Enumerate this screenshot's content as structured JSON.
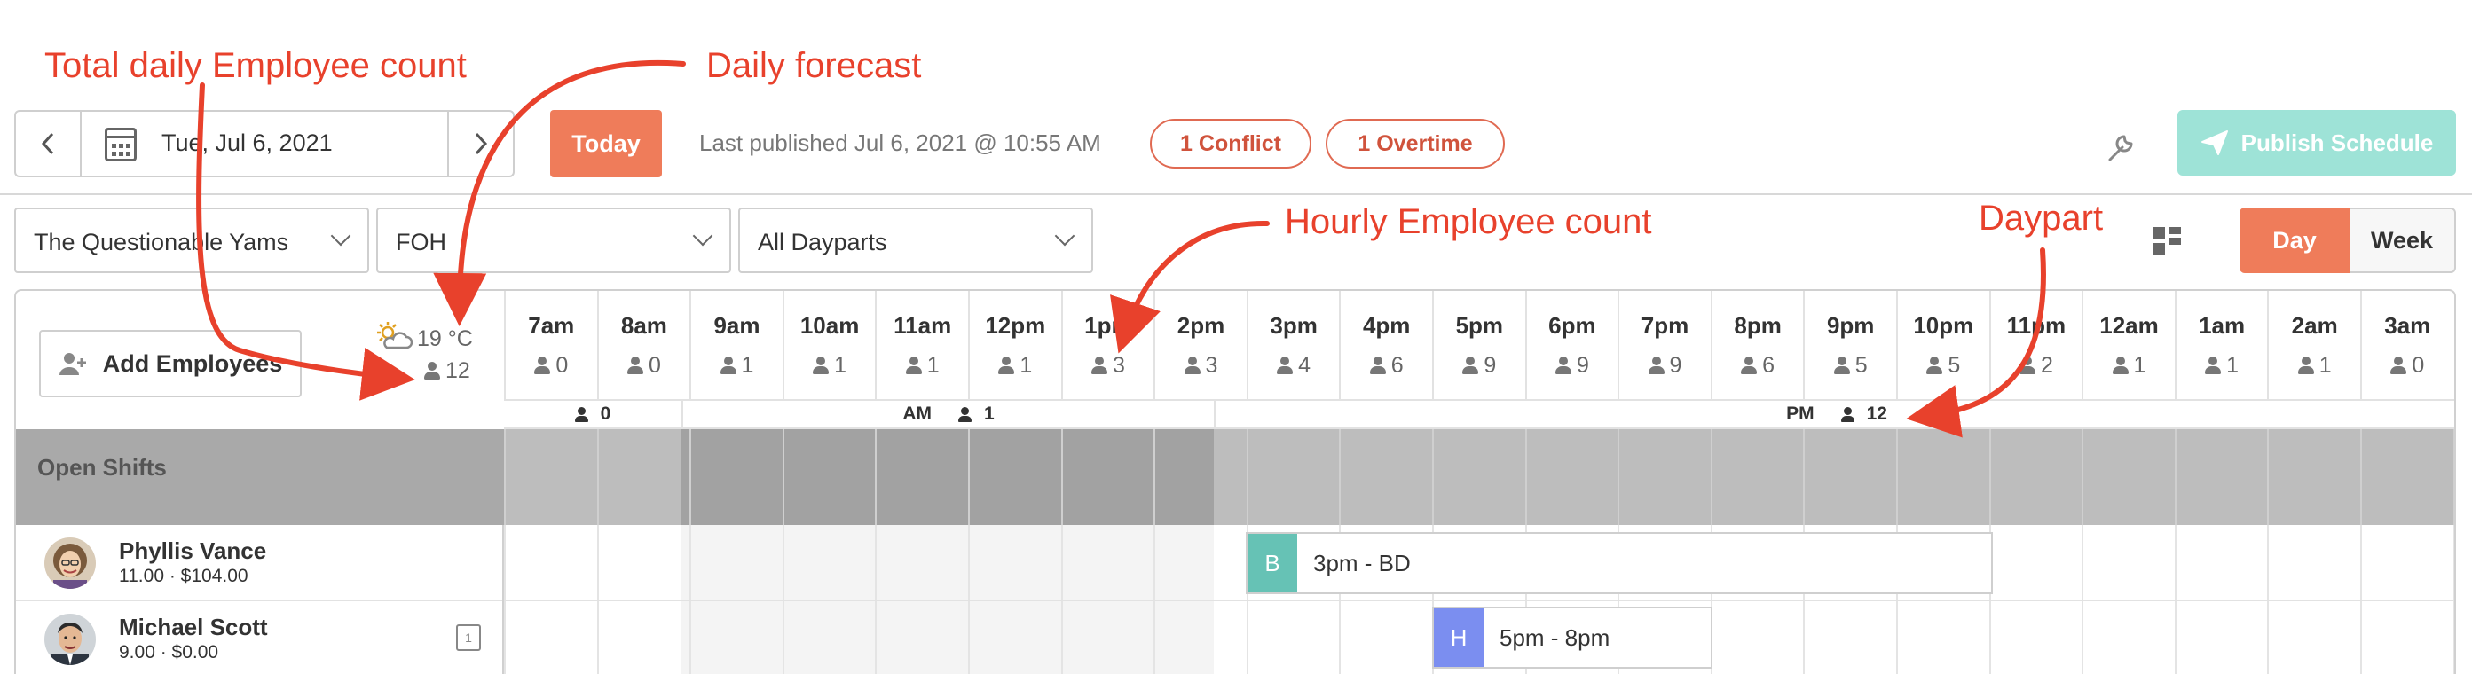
{
  "annotations": {
    "total_daily": "Total daily Employee count",
    "daily_forecast": "Daily forecast",
    "hourly_count": "Hourly Employee count",
    "daypart": "Daypart"
  },
  "toolbar": {
    "date": "Tue, Jul 6, 2021",
    "today_label": "Today",
    "last_published": "Last published Jul 6, 2021 @ 10:55 AM",
    "conflict_label": "1 Conflict",
    "overtime_label": "1 Overtime",
    "publish_label": "Publish Schedule"
  },
  "filters": {
    "location": "The Questionable Yams",
    "department": "FOH",
    "dayparts": "All Dayparts"
  },
  "view_toggle": {
    "day": "Day",
    "week": "Week"
  },
  "grid": {
    "add_employees": "Add Employees",
    "forecast": "19 °C",
    "total_employees": "12",
    "hours": [
      {
        "time": "7am",
        "count": "0"
      },
      {
        "time": "8am",
        "count": "0"
      },
      {
        "time": "9am",
        "count": "1"
      },
      {
        "time": "10am",
        "count": "1"
      },
      {
        "time": "11am",
        "count": "1"
      },
      {
        "time": "12pm",
        "count": "1"
      },
      {
        "time": "1pm",
        "count": "3"
      },
      {
        "time": "2pm",
        "count": "3"
      },
      {
        "time": "3pm",
        "count": "4"
      },
      {
        "time": "4pm",
        "count": "6"
      },
      {
        "time": "5pm",
        "count": "9"
      },
      {
        "time": "6pm",
        "count": "9"
      },
      {
        "time": "7pm",
        "count": "9"
      },
      {
        "time": "8pm",
        "count": "6"
      },
      {
        "time": "9pm",
        "count": "5"
      },
      {
        "time": "10pm",
        "count": "5"
      },
      {
        "time": "11pm",
        "count": "2"
      },
      {
        "time": "12am",
        "count": "1"
      },
      {
        "time": "1am",
        "count": "1"
      },
      {
        "time": "2am",
        "count": "1"
      },
      {
        "time": "3am",
        "count": "0"
      }
    ],
    "dayparts": {
      "none_count": "0",
      "am_label": "AM",
      "am_count": "1",
      "pm_label": "PM",
      "pm_count": "12"
    },
    "open_shifts_label": "Open Shifts",
    "employees": [
      {
        "name": "Phyllis Vance",
        "rate": "11.00 · $104.00",
        "shift_tag": "B",
        "shift_label": "3pm - BD",
        "tag_color": "#66c2b5"
      },
      {
        "name": "Michael Scott",
        "rate": "9.00 · $0.00",
        "cal_day": "1",
        "shift_tag": "H",
        "shift_label": "5pm - 8pm",
        "tag_color": "#7b8ef0"
      }
    ]
  },
  "colors": {
    "accent": "#ef7c5a",
    "annotation": "#e8412c",
    "publish_disabled": "#9ee3d7"
  }
}
